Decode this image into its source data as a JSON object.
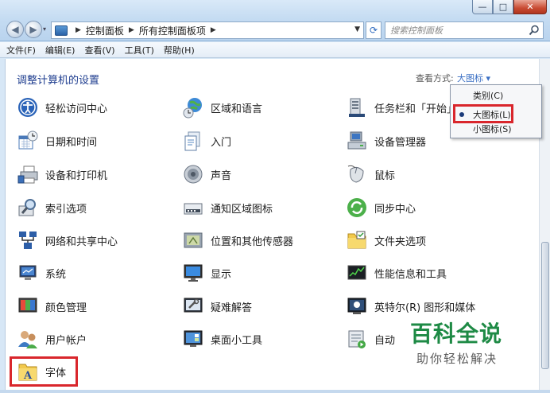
{
  "window": {
    "minimize": "—",
    "maximize": "□",
    "close": "✕"
  },
  "address": {
    "crumbs": [
      "控制面板",
      "所有控制面板项"
    ],
    "search_placeholder": "搜索控制面板"
  },
  "menu": [
    "文件(F)",
    "编辑(E)",
    "查看(V)",
    "工具(T)",
    "帮助(H)"
  ],
  "content": {
    "heading": "调整计算机的设置",
    "view_by_label": "查看方式:",
    "view_by_value": "大图标 ▾"
  },
  "items": [
    {
      "label": "轻松访问中心",
      "icon": "ease-of-access-icon"
    },
    {
      "label": "区域和语言",
      "icon": "region-language-icon"
    },
    {
      "label": "任务栏和「开始」",
      "icon": "taskbar-start-icon"
    },
    {
      "label": "日期和时间",
      "icon": "date-time-icon"
    },
    {
      "label": "入门",
      "icon": "getting-started-icon"
    },
    {
      "label": "设备管理器",
      "icon": "device-manager-icon"
    },
    {
      "label": "设备和打印机",
      "icon": "devices-printers-icon"
    },
    {
      "label": "声音",
      "icon": "sound-icon"
    },
    {
      "label": "鼠标",
      "icon": "mouse-icon"
    },
    {
      "label": "索引选项",
      "icon": "indexing-options-icon"
    },
    {
      "label": "通知区域图标",
      "icon": "notification-area-icon"
    },
    {
      "label": "同步中心",
      "icon": "sync-center-icon"
    },
    {
      "label": "网络和共享中心",
      "icon": "network-sharing-icon"
    },
    {
      "label": "位置和其他传感器",
      "icon": "location-sensors-icon"
    },
    {
      "label": "文件夹选项",
      "icon": "folder-options-icon"
    },
    {
      "label": "系统",
      "icon": "system-icon"
    },
    {
      "label": "显示",
      "icon": "display-icon"
    },
    {
      "label": "性能信息和工具",
      "icon": "performance-icon"
    },
    {
      "label": "颜色管理",
      "icon": "color-management-icon"
    },
    {
      "label": "疑难解答",
      "icon": "troubleshooting-icon"
    },
    {
      "label": "英特尔(R) 图形和媒体",
      "icon": "intel-graphics-icon"
    },
    {
      "label": "用户帐户",
      "icon": "user-accounts-icon"
    },
    {
      "label": "桌面小工具",
      "icon": "desktop-gadgets-icon"
    },
    {
      "label": "自动",
      "icon": "autoplay-icon"
    },
    {
      "label": "字体",
      "icon": "fonts-icon"
    }
  ],
  "dropdown": {
    "options": [
      "类别(C)",
      "大图标(L)",
      "小图标(S)"
    ],
    "selected": "大图标(L)"
  },
  "watermark": {
    "title": "百科全说",
    "subtitle": "助你轻松解决"
  }
}
